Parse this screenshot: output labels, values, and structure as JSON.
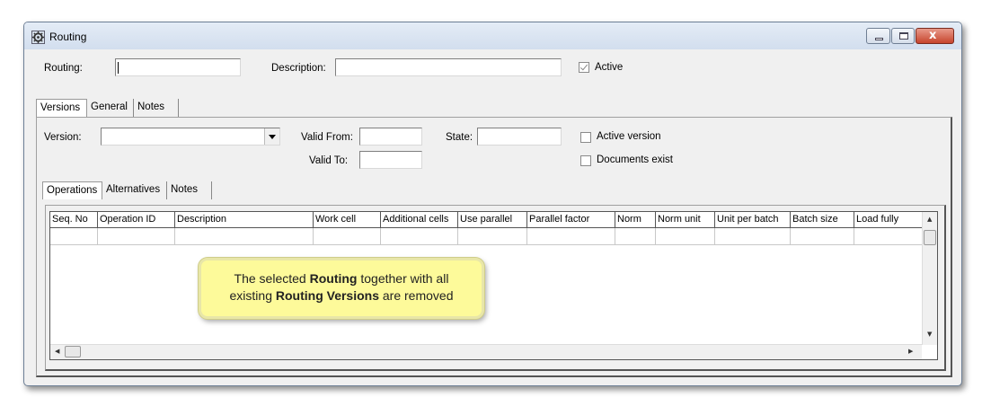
{
  "window": {
    "title": "Routing",
    "close_glyph": "x"
  },
  "header": {
    "routing_label": "Routing:",
    "routing_value": "",
    "description_label": "Description:",
    "description_value": "",
    "active_label": "Active",
    "active_checked": true
  },
  "tabs_top": [
    "Versions",
    "General",
    "Notes"
  ],
  "version": {
    "version_label": "Version:",
    "version_value": "",
    "valid_from_label": "Valid From:",
    "valid_to_label": "Valid To:",
    "state_label": "State:",
    "active_version_label": "Active version",
    "documents_exist_label": "Documents exist"
  },
  "tabs_inner": [
    "Operations",
    "Alternatives",
    "Notes"
  ],
  "table": {
    "columns": [
      "Seq. No",
      "Operation ID",
      "Description",
      "Work cell",
      "Additional cells",
      "Use parallel",
      "Parallel factor",
      "Norm",
      "Norm unit",
      "Unit per batch",
      "Batch size",
      "Load fully"
    ]
  },
  "callout": {
    "line1_pre": "The selected ",
    "line1_bold": "Routing",
    "line1_post": " together with all",
    "line2_pre": "existing ",
    "line2_bold": "Routing Versions",
    "line2_post": " are removed"
  }
}
